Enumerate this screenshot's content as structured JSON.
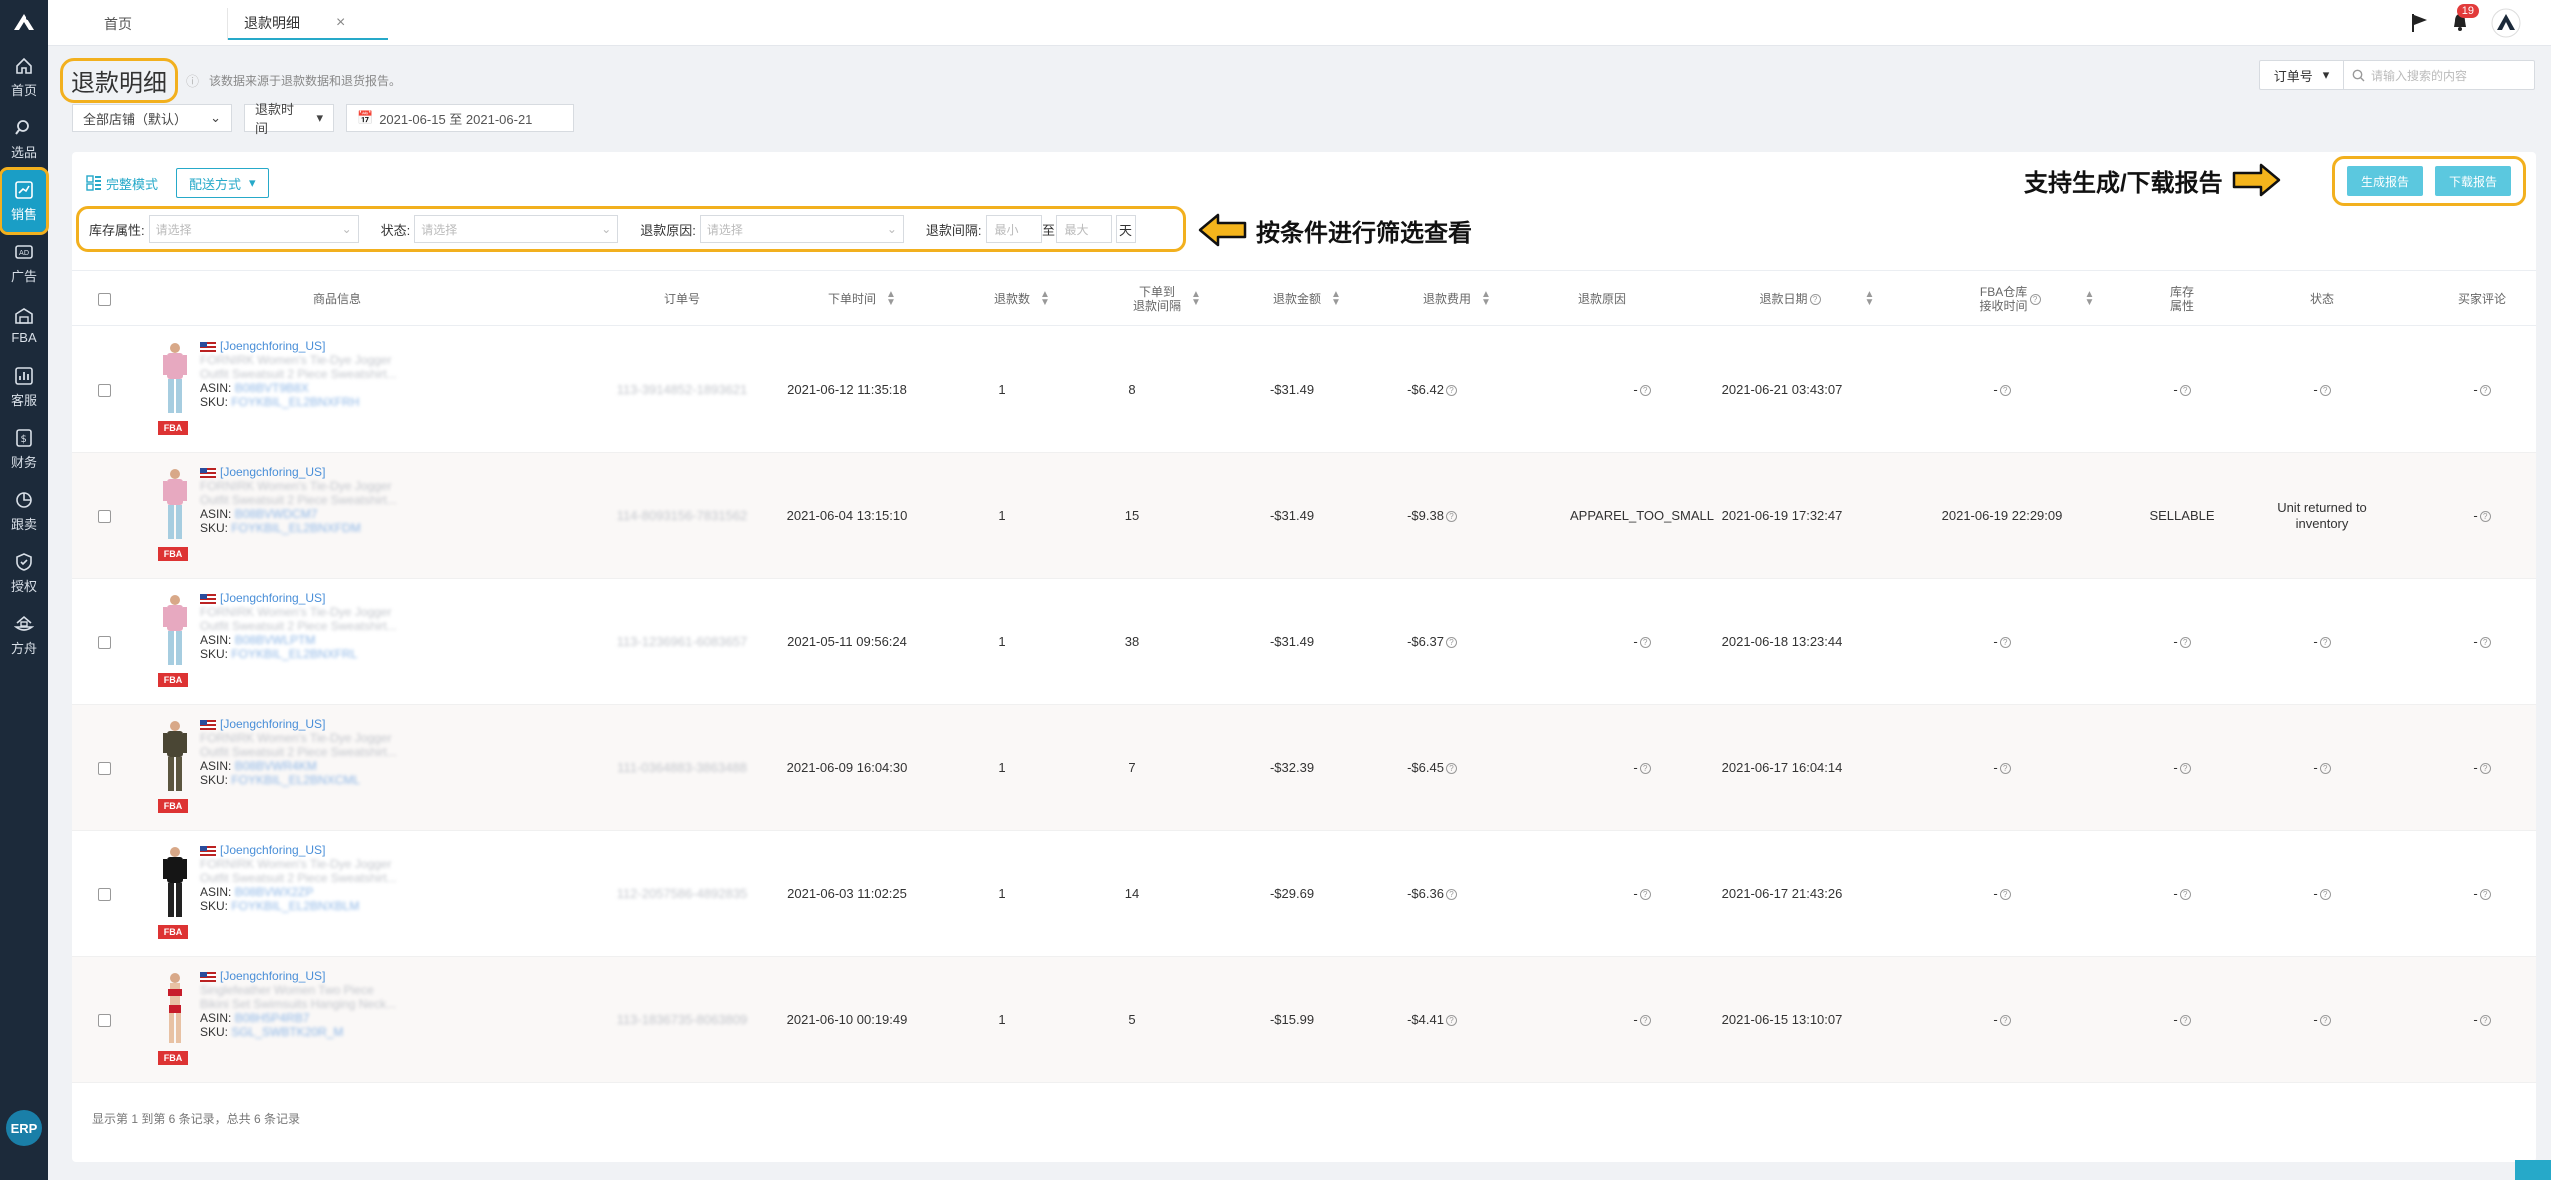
{
  "sidebar": {
    "items": [
      {
        "label": "首页",
        "icon": "home-icon"
      },
      {
        "label": "选品",
        "icon": "search-icon"
      },
      {
        "label": "销售",
        "icon": "chart-icon",
        "active": true
      },
      {
        "label": "广告",
        "icon": "ad-icon"
      },
      {
        "label": "FBA",
        "icon": "warehouse-icon"
      },
      {
        "label": "客服",
        "icon": "service-icon"
      },
      {
        "label": "财务",
        "icon": "dollar-icon"
      },
      {
        "label": "跟卖",
        "icon": "pie-icon"
      },
      {
        "label": "授权",
        "icon": "shield-icon"
      },
      {
        "label": "方舟",
        "icon": "ark-icon"
      }
    ],
    "erp": "ERP"
  },
  "tabs": [
    {
      "label": "首页"
    },
    {
      "label": "退款明细",
      "close": "×"
    }
  ],
  "notifications": {
    "count": "19"
  },
  "page": {
    "title": "退款明细",
    "description": "该数据来源于退款数据和退货报告。"
  },
  "search": {
    "field": "订单号",
    "placeholder": "请输入搜索的内容"
  },
  "filters": {
    "store": "全部店铺（默认）",
    "date_type": "退款时间",
    "date_range": "2021-06-15 至 2021-06-21"
  },
  "toolbar": {
    "view_mode": "完整模式",
    "distribution": "配送方式",
    "generate_report": "生成报告",
    "download_report": "下载报告"
  },
  "filter_row": {
    "inventory_label": "库存属性:",
    "status_label": "状态:",
    "reason_label": "退款原因:",
    "interval_label": "退款间隔:",
    "placeholder": "请选择",
    "min": "最小",
    "to": "至",
    "max": "最大",
    "unit": "天"
  },
  "annotations": {
    "filter": "按条件进行筛选查看",
    "report": "支持生成/下载报告"
  },
  "table": {
    "headers": {
      "product": "商品信息",
      "order": "订单号",
      "order_time": "下单时间",
      "qty": "退款数",
      "interval": "下单到\n退款间隔",
      "amount": "退款金额",
      "fee": "退款费用",
      "reason": "退款原因",
      "refund_date": "退款日期",
      "fba_time": "FBA仓库\n接收时间",
      "inventory": "库存\n属性",
      "status": "状态",
      "review": "买家评论"
    },
    "rows": [
      {
        "shop": "[Joengchforing_US]",
        "title1": "FORNIRK Women's Tie-Dye Jogger",
        "title2": "Outfit Sweatsuit 2 Piece Sweatshirt...",
        "asin": "B08BVT9B8X",
        "sku": "FOYKBIL_EL2BNXFRH",
        "order": "113-3914852-1893621",
        "order_time": "2021-06-12 11:35:18",
        "qty": "1",
        "interval": "8",
        "amount": "-$31.49",
        "fee": "-$6.42",
        "reason": "-",
        "refund_date": "2021-06-21 03:43:07",
        "fba_time": "-",
        "inventory": "-",
        "status": "-",
        "review": "-",
        "image": "tie-dye"
      },
      {
        "shop": "[Joengchforing_US]",
        "title1": "FORNIRK Women's Tie-Dye Jogger",
        "title2": "Outfit Sweatsuit 2 Piece Sweatshirt...",
        "asin": "B08BVWDCM7",
        "sku": "FOYKBIL_EL2BNXFDM",
        "order": "114-8093156-7831562",
        "order_time": "2021-06-04 13:15:10",
        "qty": "1",
        "interval": "15",
        "amount": "-$31.49",
        "fee": "-$9.38",
        "reason": "APPAREL_TOO_SMALL",
        "refund_date": "2021-06-19 17:32:47",
        "fba_time": "2021-06-19 22:29:09",
        "inventory": "SELLABLE",
        "status": "Unit returned to inventory",
        "review": "-",
        "image": "tie-dye"
      },
      {
        "shop": "[Joengchforing_US]",
        "title1": "FORNIRK Women's Tie-Dye Jogger",
        "title2": "Outfit Sweatsuit 2 Piece Sweatshirt...",
        "asin": "B08BVWLPTM",
        "sku": "FOYKBIL_EL2BNXFRL",
        "order": "113-1236961-6083657",
        "order_time": "2021-05-11 09:56:24",
        "qty": "1",
        "interval": "38",
        "amount": "-$31.49",
        "fee": "-$6.37",
        "reason": "-",
        "refund_date": "2021-06-18 13:23:44",
        "fba_time": "-",
        "inventory": "-",
        "status": "-",
        "review": "-",
        "image": "tie-dye"
      },
      {
        "shop": "[Joengchforing_US]",
        "title1": "FORNIRK Women's Tie-Dye Jogger",
        "title2": "Outfit Sweatsuit 2 Piece Sweatshirt...",
        "asin": "B08BVWR4KM",
        "sku": "FOYKBIL_EL2BNXCML",
        "order": "111-0364883-3863488",
        "order_time": "2021-06-09 16:04:30",
        "qty": "1",
        "interval": "7",
        "amount": "-$32.39",
        "fee": "-$6.45",
        "reason": "-",
        "refund_date": "2021-06-17 16:04:14",
        "fba_time": "-",
        "inventory": "-",
        "status": "-",
        "review": "-",
        "image": "camo"
      },
      {
        "shop": "[Joengchforing_US]",
        "title1": "FORNIRK Women's Tie-Dye Jogger",
        "title2": "Outfit Sweatsuit 2 Piece Sweatshirt...",
        "asin": "B08BVWX2ZP",
        "sku": "FOYKBIL_EL2BNXBLM",
        "order": "112-2057586-4892835",
        "order_time": "2021-06-03 11:02:25",
        "qty": "1",
        "interval": "14",
        "amount": "-$29.69",
        "fee": "-$6.36",
        "reason": "-",
        "refund_date": "2021-06-17 21:43:26",
        "fba_time": "-",
        "inventory": "-",
        "status": "-",
        "review": "-",
        "image": "black"
      },
      {
        "shop": "[Joengchforing_US]",
        "title1": "Singlefeather Women Two Piece",
        "title2": "Bikini Set Swimsuits Hanging Neck...",
        "asin": "B08H5P4RB7",
        "sku": "SGL_SWBTK20R_M",
        "order": "113-1836735-8063809",
        "order_time": "2021-06-10 00:19:49",
        "qty": "1",
        "interval": "5",
        "amount": "-$15.99",
        "fee": "-$4.41",
        "reason": "-",
        "refund_date": "2021-06-15 13:10:07",
        "fba_time": "-",
        "inventory": "-",
        "status": "-",
        "review": "-",
        "image": "bikini"
      }
    ]
  },
  "footer": "显示第 1 到第 6 条记录，总共 6 条记录",
  "colors": {
    "accent": "#26a9c9",
    "highlight": "#f2b01e",
    "sidebar": "#1c2a3a"
  }
}
